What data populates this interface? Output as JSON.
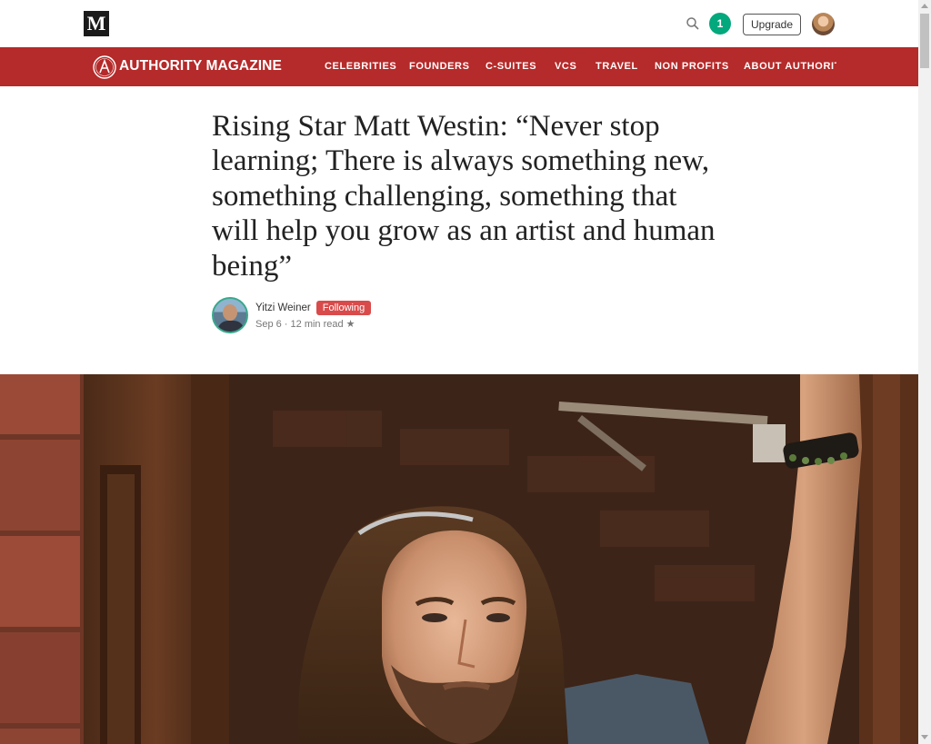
{
  "topbar": {
    "logo_letter": "M",
    "search_icon": "search-icon",
    "notification_count": "1",
    "notification_color": "#03a87c",
    "upgrade_label": "Upgrade"
  },
  "publication": {
    "name": "AUTHORITY MAGAZINE",
    "bar_color": "#b52a2a",
    "nav": [
      "CELEBRITIES",
      "FOUNDERS",
      "C-SUITES",
      "VCS",
      "TRAVEL",
      "NON PROFITS",
      "ABOUT AUTHORITY"
    ]
  },
  "article": {
    "title": "Rising Star Matt Westin: “Never stop learning; There is always something new, something challenging, something that will help you grow as an artist and human being”",
    "author": "Yitzi Weiner",
    "follow_status": "Following",
    "meta": "Sep 6 · 12 min read ★",
    "follow_badge_color": "#d94b4b"
  }
}
